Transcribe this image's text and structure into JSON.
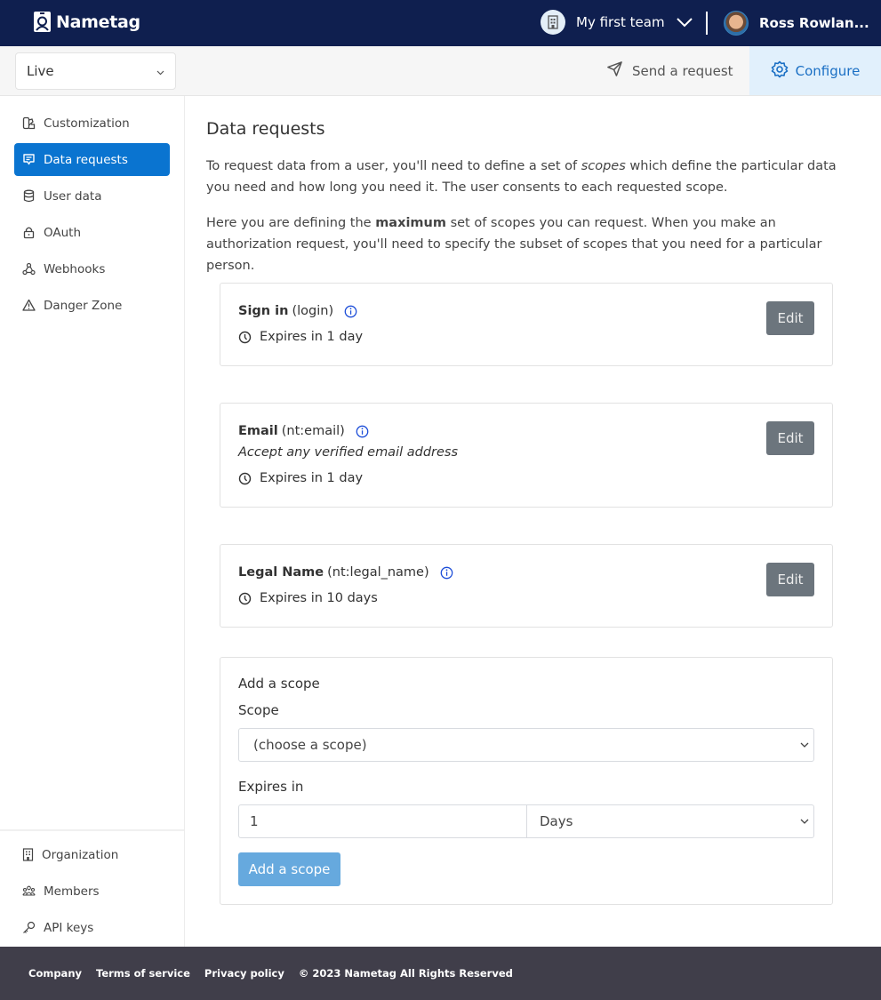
{
  "topbar": {
    "brand": "Nametag",
    "team_name": "My first team",
    "user_name": "Ross Rowlan..."
  },
  "subbar": {
    "environment": "Live",
    "send_request": "Send a request",
    "configure": "Configure"
  },
  "sidebar": {
    "items": [
      {
        "label": "Customization",
        "icon": "palette-icon"
      },
      {
        "label": "Data requests",
        "icon": "message-icon",
        "active": true
      },
      {
        "label": "User data",
        "icon": "database-icon"
      },
      {
        "label": "OAuth",
        "icon": "lock-icon"
      },
      {
        "label": "Webhooks",
        "icon": "webhook-icon"
      },
      {
        "label": "Danger Zone",
        "icon": "warning-icon"
      }
    ],
    "bottom_items": [
      {
        "label": "Organization",
        "icon": "building-icon"
      },
      {
        "label": "Members",
        "icon": "users-icon"
      },
      {
        "label": "API keys",
        "icon": "key-icon"
      }
    ]
  },
  "main": {
    "title": "Data requests",
    "para1_pre": "To request data from a user, you'll need to define a set of ",
    "para1_em": "scopes",
    "para1_post": " which define the particular data you need and how long you need it. The user consents to each requested scope.",
    "para2_pre": "Here you are defining the ",
    "para2_strong": "maximum",
    "para2_post": " set of scopes you can request. When you make an authorization request, you'll need to specify the subset of scopes that you need for a particular person.",
    "scopes": [
      {
        "name": "Sign in",
        "code": "(login)",
        "description": "",
        "expires": "Expires in 1 day",
        "edit_label": "Edit"
      },
      {
        "name": "Email",
        "code": "(nt:email)",
        "description": "Accept any verified email address",
        "expires": "Expires in 1 day",
        "edit_label": "Edit"
      },
      {
        "name": "Legal Name",
        "code": "(nt:legal_name)",
        "description": "",
        "expires": "Expires in 10 days",
        "edit_label": "Edit"
      }
    ],
    "add_scope": {
      "heading": "Add a scope",
      "scope_label": "Scope",
      "scope_value": "(choose a scope)",
      "expires_label": "Expires in",
      "expires_value": "1",
      "unit_value": "Days",
      "button_label": "Add a scope"
    }
  },
  "footer": {
    "links": [
      "Company",
      "Terms of service",
      "Privacy policy"
    ],
    "copyright": "© 2023 Nametag All Rights Reserved"
  },
  "colors": {
    "navbar": "#0f1f4f",
    "accent": "#0a74d0",
    "configure_bg": "#e1f0fc",
    "edit_button": "#6c757d",
    "add_button": "#66a9de",
    "footer": "#403e4a"
  }
}
